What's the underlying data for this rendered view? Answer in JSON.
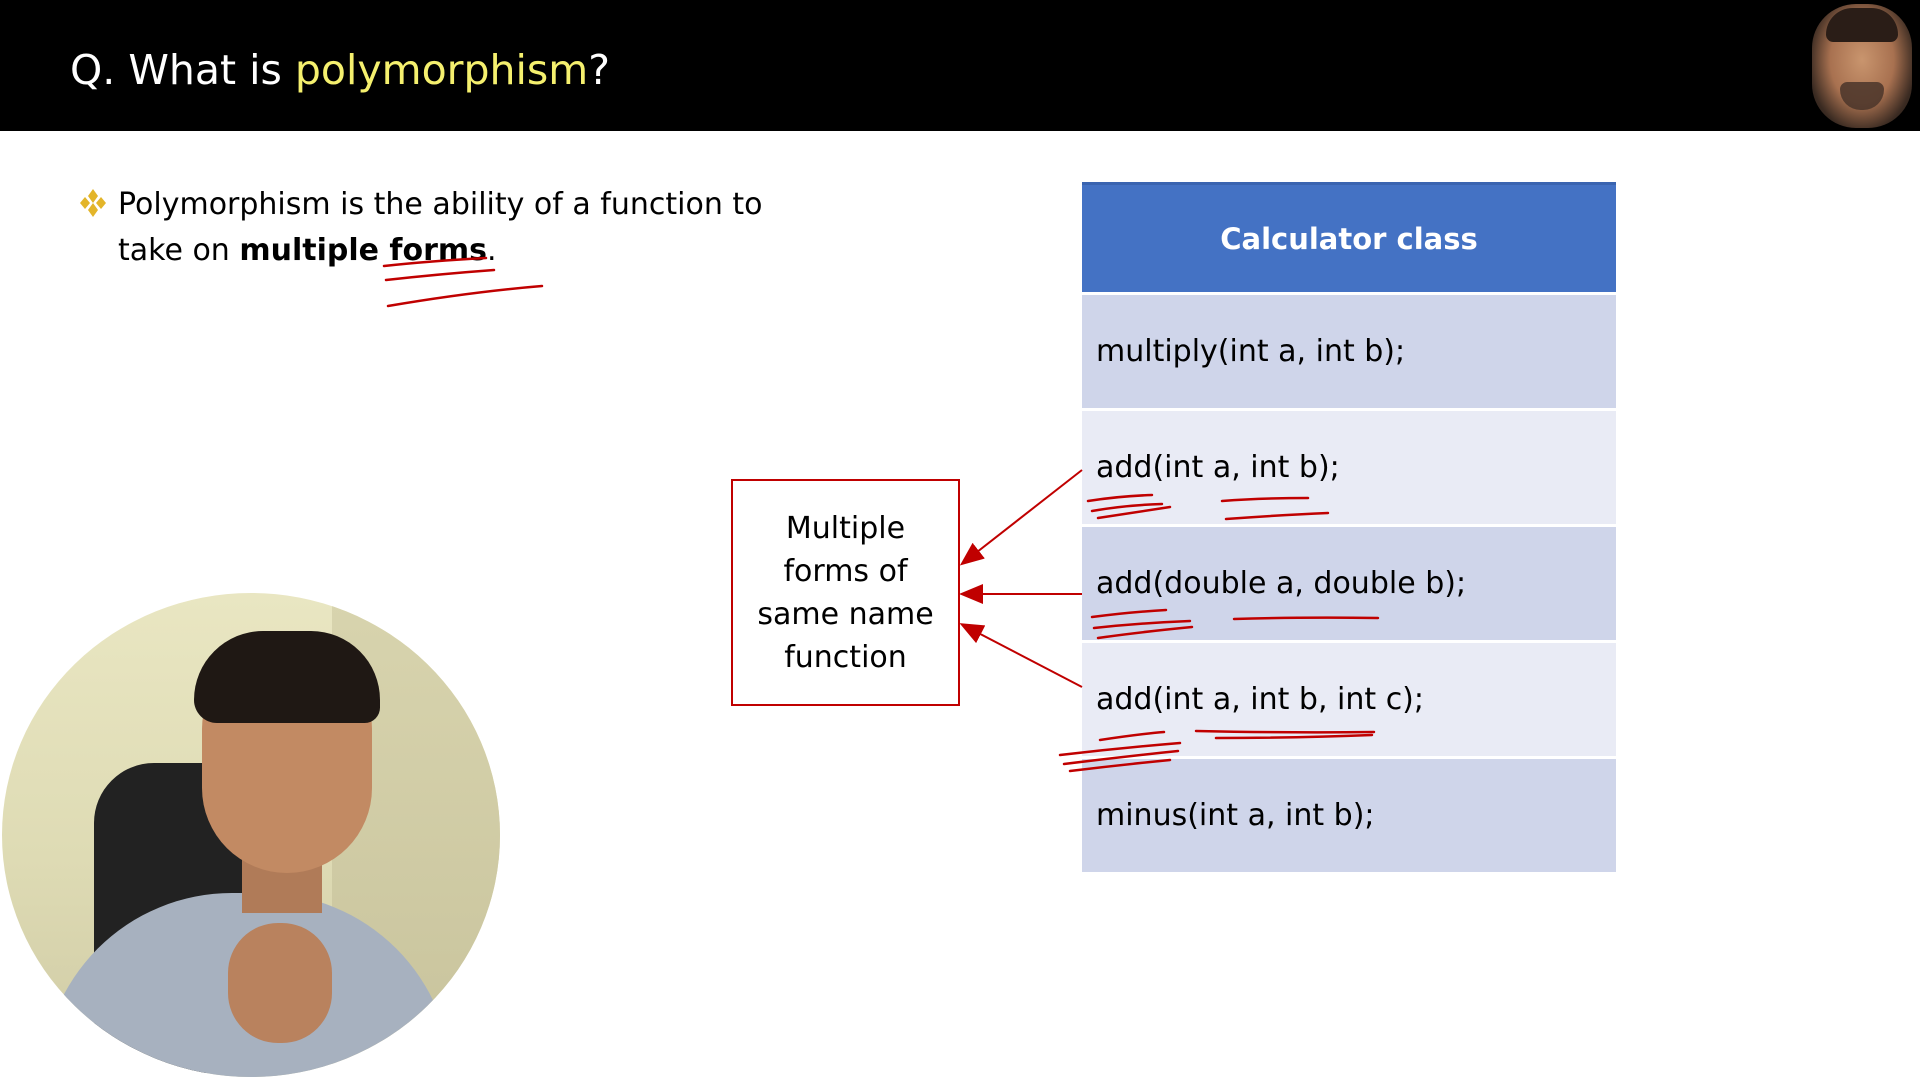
{
  "header": {
    "title_prefix": "Q. What is ",
    "title_highlight": "polymorphism",
    "title_suffix": "?"
  },
  "bullet": {
    "text_before": "Polymorphism is the ability of a function to take on ",
    "text_bold": "multiple forms",
    "text_after": "."
  },
  "diagram": {
    "box_lines": [
      "Multiple",
      "forms of",
      "same name",
      "function"
    ],
    "table_header": "Calculator class",
    "rows": [
      "multiply(int a, int b);",
      "add(int a, int b);",
      "add(double a, double b);",
      "add(int a, int b, int c);",
      "minus(int a, int b);"
    ]
  },
  "colors": {
    "header_bg": "#000000",
    "title_highlight": "#f5f06e",
    "table_header_bg": "#4472c4",
    "row_dark": "#cfd5ea",
    "row_light": "#e9ebf5",
    "annotation_red": "#c00000",
    "bullet_gold": "#e3b52a"
  },
  "icons": {
    "bullet": "four-diamond-bullet-icon",
    "presenter": "presenter-video",
    "corner": "presenter-avatar"
  }
}
